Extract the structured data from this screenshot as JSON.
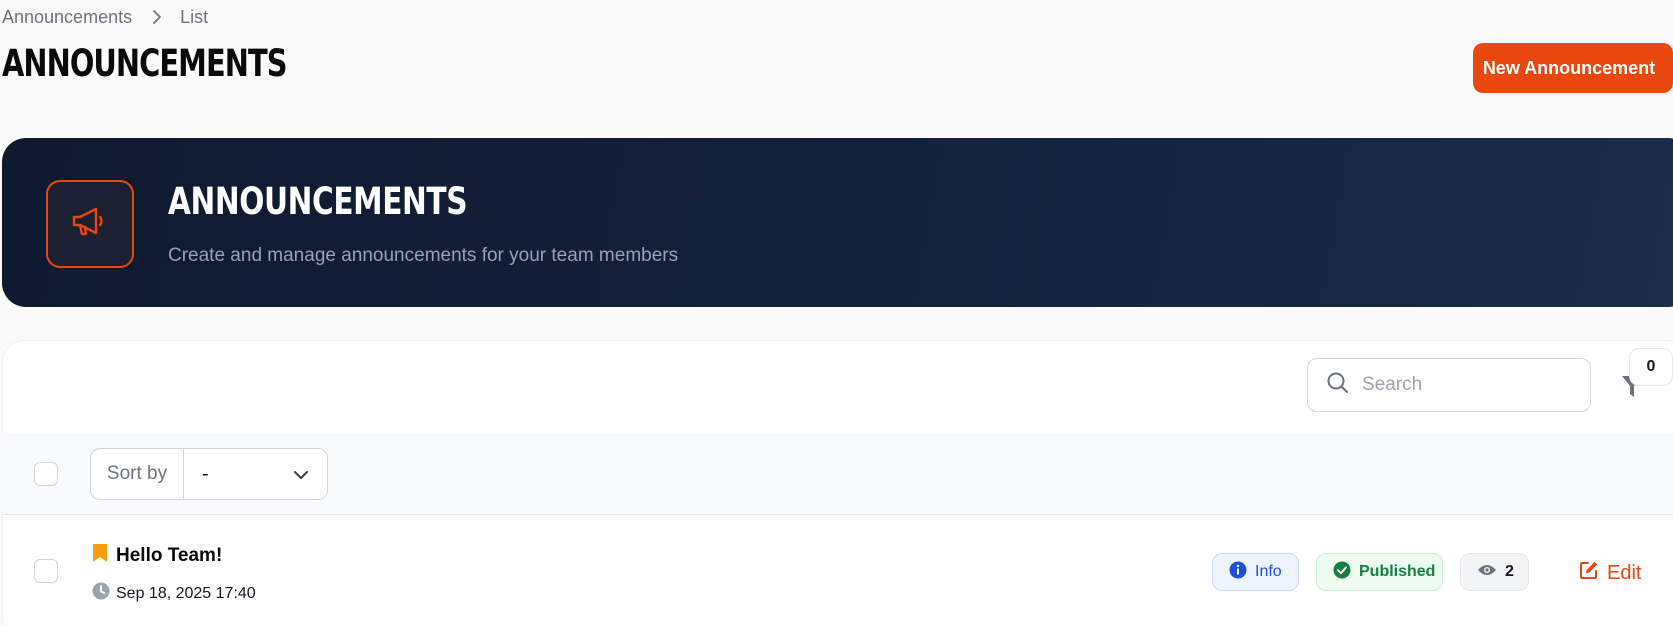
{
  "breadcrumb": {
    "root": "Announcements",
    "current": "List"
  },
  "page": {
    "title": "ANNOUNCEMENTS",
    "new_button": "New Announcement"
  },
  "hero": {
    "title": "ANNOUNCEMENTS",
    "subtitle": "Create and manage announcements for your team members",
    "icon": "megaphone-icon"
  },
  "toolbar": {
    "search_placeholder": "Search",
    "filter_count": "0",
    "sort_label": "Sort by",
    "sort_value": "-"
  },
  "rows": [
    {
      "title": "Hello Team!",
      "date": "Sep 18, 2025 17:40",
      "type": "Info",
      "status": "Published",
      "views": "2",
      "edit_label": "Edit"
    }
  ],
  "colors": {
    "accent": "#e8470e",
    "hero_bg": "#0f1a30",
    "info": "#1d4ed8",
    "published": "#15803d",
    "bookmark": "#f59e0b"
  }
}
